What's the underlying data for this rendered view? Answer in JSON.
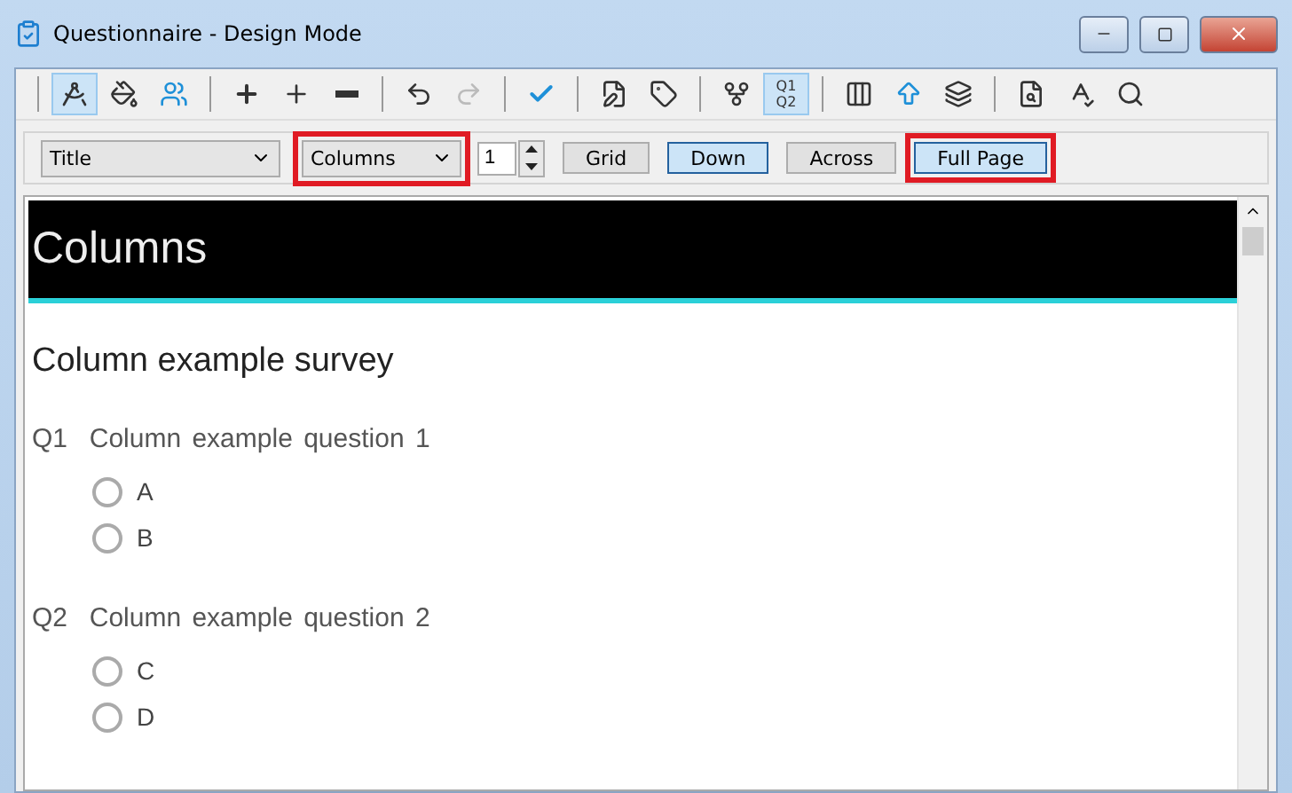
{
  "window": {
    "title": "Questionnaire - Design Mode"
  },
  "toolbar": [
    [
      {
        "kind": "design",
        "selected": true,
        "disabled": false
      },
      {
        "kind": "fill",
        "selected": false,
        "disabled": false
      },
      {
        "kind": "people",
        "selected": false,
        "disabled": false
      }
    ],
    [
      {
        "kind": "add",
        "selected": false,
        "disabled": false
      },
      {
        "kind": "addmany",
        "selected": false,
        "disabled": false
      },
      {
        "kind": "remove",
        "selected": false,
        "disabled": false
      }
    ],
    [
      {
        "kind": "undo",
        "selected": false,
        "disabled": false
      },
      {
        "kind": "redo",
        "selected": false,
        "disabled": true
      }
    ],
    [
      {
        "kind": "check",
        "selected": false,
        "disabled": false
      }
    ],
    [
      {
        "kind": "editdoc",
        "selected": false,
        "disabled": false
      },
      {
        "kind": "filltag",
        "selected": false,
        "disabled": false
      }
    ],
    [
      {
        "kind": "branch",
        "selected": false,
        "disabled": false
      },
      {
        "kind": "numbering",
        "selected": true,
        "disabled": false,
        "lines": [
          "Q1",
          "Q2"
        ]
      }
    ],
    [
      {
        "kind": "columns",
        "selected": false,
        "disabled": false
      },
      {
        "kind": "upload",
        "selected": false,
        "disabled": false
      },
      {
        "kind": "layers",
        "selected": false,
        "disabled": false
      }
    ],
    [
      {
        "kind": "preview",
        "selected": false,
        "disabled": false
      },
      {
        "kind": "spell",
        "selected": false,
        "disabled": false
      },
      {
        "kind": "search",
        "selected": false,
        "disabled": false
      }
    ]
  ],
  "format_bar": {
    "style": {
      "value": "Title",
      "highlighted": false
    },
    "layout": {
      "value": "Columns",
      "highlighted": true
    },
    "count": "1",
    "buttons": [
      {
        "label": "Grid",
        "selected": false,
        "highlighted": false
      },
      {
        "label": "Down",
        "selected": true,
        "highlighted": false
      },
      {
        "label": "Across",
        "selected": false,
        "highlighted": false
      },
      {
        "label": "Full Page",
        "selected": true,
        "highlighted": true
      }
    ]
  },
  "page": {
    "header": "Columns",
    "title": "Column example survey",
    "questions": [
      {
        "number": "Q1",
        "text": "Column example question 1",
        "options": [
          {
            "label": "A",
            "selected": false
          },
          {
            "label": "B",
            "selected": false
          }
        ]
      },
      {
        "number": "Q2",
        "text": "Column example question 2",
        "options": [
          {
            "label": "C",
            "selected": false
          },
          {
            "label": "D",
            "selected": false
          }
        ]
      }
    ]
  }
}
